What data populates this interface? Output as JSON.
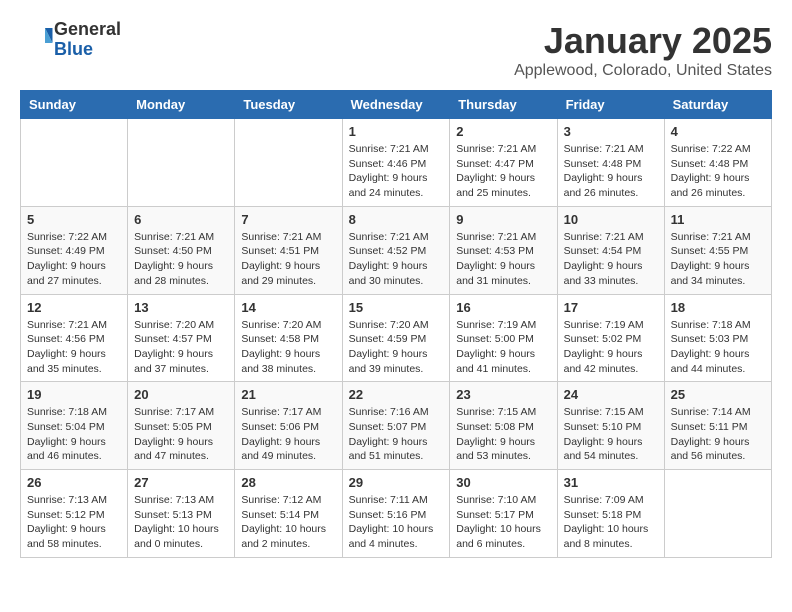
{
  "logo": {
    "general": "General",
    "blue": "Blue"
  },
  "header": {
    "month": "January 2025",
    "location": "Applewood, Colorado, United States"
  },
  "weekdays": [
    "Sunday",
    "Monday",
    "Tuesday",
    "Wednesday",
    "Thursday",
    "Friday",
    "Saturday"
  ],
  "weeks": [
    [
      {
        "day": "",
        "info": ""
      },
      {
        "day": "",
        "info": ""
      },
      {
        "day": "",
        "info": ""
      },
      {
        "day": "1",
        "info": "Sunrise: 7:21 AM\nSunset: 4:46 PM\nDaylight: 9 hours\nand 24 minutes."
      },
      {
        "day": "2",
        "info": "Sunrise: 7:21 AM\nSunset: 4:47 PM\nDaylight: 9 hours\nand 25 minutes."
      },
      {
        "day": "3",
        "info": "Sunrise: 7:21 AM\nSunset: 4:48 PM\nDaylight: 9 hours\nand 26 minutes."
      },
      {
        "day": "4",
        "info": "Sunrise: 7:22 AM\nSunset: 4:48 PM\nDaylight: 9 hours\nand 26 minutes."
      }
    ],
    [
      {
        "day": "5",
        "info": "Sunrise: 7:22 AM\nSunset: 4:49 PM\nDaylight: 9 hours\nand 27 minutes."
      },
      {
        "day": "6",
        "info": "Sunrise: 7:21 AM\nSunset: 4:50 PM\nDaylight: 9 hours\nand 28 minutes."
      },
      {
        "day": "7",
        "info": "Sunrise: 7:21 AM\nSunset: 4:51 PM\nDaylight: 9 hours\nand 29 minutes."
      },
      {
        "day": "8",
        "info": "Sunrise: 7:21 AM\nSunset: 4:52 PM\nDaylight: 9 hours\nand 30 minutes."
      },
      {
        "day": "9",
        "info": "Sunrise: 7:21 AM\nSunset: 4:53 PM\nDaylight: 9 hours\nand 31 minutes."
      },
      {
        "day": "10",
        "info": "Sunrise: 7:21 AM\nSunset: 4:54 PM\nDaylight: 9 hours\nand 33 minutes."
      },
      {
        "day": "11",
        "info": "Sunrise: 7:21 AM\nSunset: 4:55 PM\nDaylight: 9 hours\nand 34 minutes."
      }
    ],
    [
      {
        "day": "12",
        "info": "Sunrise: 7:21 AM\nSunset: 4:56 PM\nDaylight: 9 hours\nand 35 minutes."
      },
      {
        "day": "13",
        "info": "Sunrise: 7:20 AM\nSunset: 4:57 PM\nDaylight: 9 hours\nand 37 minutes."
      },
      {
        "day": "14",
        "info": "Sunrise: 7:20 AM\nSunset: 4:58 PM\nDaylight: 9 hours\nand 38 minutes."
      },
      {
        "day": "15",
        "info": "Sunrise: 7:20 AM\nSunset: 4:59 PM\nDaylight: 9 hours\nand 39 minutes."
      },
      {
        "day": "16",
        "info": "Sunrise: 7:19 AM\nSunset: 5:00 PM\nDaylight: 9 hours\nand 41 minutes."
      },
      {
        "day": "17",
        "info": "Sunrise: 7:19 AM\nSunset: 5:02 PM\nDaylight: 9 hours\nand 42 minutes."
      },
      {
        "day": "18",
        "info": "Sunrise: 7:18 AM\nSunset: 5:03 PM\nDaylight: 9 hours\nand 44 minutes."
      }
    ],
    [
      {
        "day": "19",
        "info": "Sunrise: 7:18 AM\nSunset: 5:04 PM\nDaylight: 9 hours\nand 46 minutes."
      },
      {
        "day": "20",
        "info": "Sunrise: 7:17 AM\nSunset: 5:05 PM\nDaylight: 9 hours\nand 47 minutes."
      },
      {
        "day": "21",
        "info": "Sunrise: 7:17 AM\nSunset: 5:06 PM\nDaylight: 9 hours\nand 49 minutes."
      },
      {
        "day": "22",
        "info": "Sunrise: 7:16 AM\nSunset: 5:07 PM\nDaylight: 9 hours\nand 51 minutes."
      },
      {
        "day": "23",
        "info": "Sunrise: 7:15 AM\nSunset: 5:08 PM\nDaylight: 9 hours\nand 53 minutes."
      },
      {
        "day": "24",
        "info": "Sunrise: 7:15 AM\nSunset: 5:10 PM\nDaylight: 9 hours\nand 54 minutes."
      },
      {
        "day": "25",
        "info": "Sunrise: 7:14 AM\nSunset: 5:11 PM\nDaylight: 9 hours\nand 56 minutes."
      }
    ],
    [
      {
        "day": "26",
        "info": "Sunrise: 7:13 AM\nSunset: 5:12 PM\nDaylight: 9 hours\nand 58 minutes."
      },
      {
        "day": "27",
        "info": "Sunrise: 7:13 AM\nSunset: 5:13 PM\nDaylight: 10 hours\nand 0 minutes."
      },
      {
        "day": "28",
        "info": "Sunrise: 7:12 AM\nSunset: 5:14 PM\nDaylight: 10 hours\nand 2 minutes."
      },
      {
        "day": "29",
        "info": "Sunrise: 7:11 AM\nSunset: 5:16 PM\nDaylight: 10 hours\nand 4 minutes."
      },
      {
        "day": "30",
        "info": "Sunrise: 7:10 AM\nSunset: 5:17 PM\nDaylight: 10 hours\nand 6 minutes."
      },
      {
        "day": "31",
        "info": "Sunrise: 7:09 AM\nSunset: 5:18 PM\nDaylight: 10 hours\nand 8 minutes."
      },
      {
        "day": "",
        "info": ""
      }
    ]
  ]
}
